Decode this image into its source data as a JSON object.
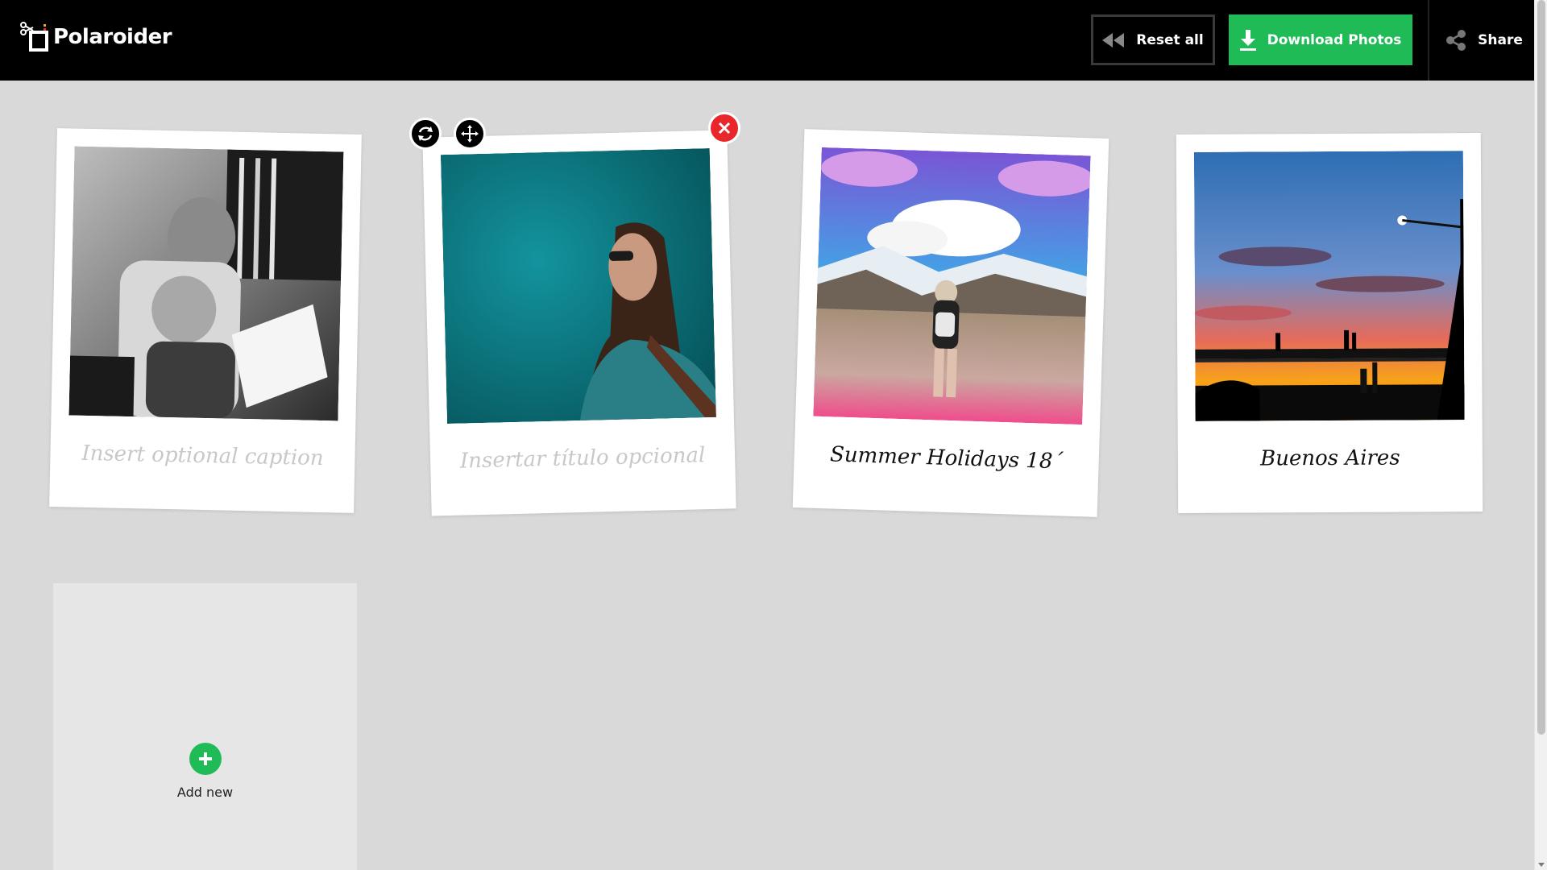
{
  "app": {
    "name": "Polaroider"
  },
  "header": {
    "reset_label": "Reset all",
    "download_label": "Download Photos",
    "share_label": "Share"
  },
  "polaroids": [
    {
      "caption": "Insert optional caption",
      "is_placeholder": true
    },
    {
      "caption": "Insertar título opcional",
      "is_placeholder": true
    },
    {
      "caption": "Summer Holidays 18´",
      "is_placeholder": false
    },
    {
      "caption": "Buenos Aires",
      "is_placeholder": false
    }
  ],
  "add_new": {
    "label": "Add new"
  },
  "colors": {
    "header_bg": "#000000",
    "accent_green": "#1fbb56",
    "close_red": "#e8262b",
    "page_bg": "#d9d9d9"
  },
  "icons": [
    "logo-icon",
    "rewind-icon",
    "download-icon",
    "share-icon",
    "rotate-icon",
    "move-icon",
    "close-icon",
    "plus-icon"
  ]
}
